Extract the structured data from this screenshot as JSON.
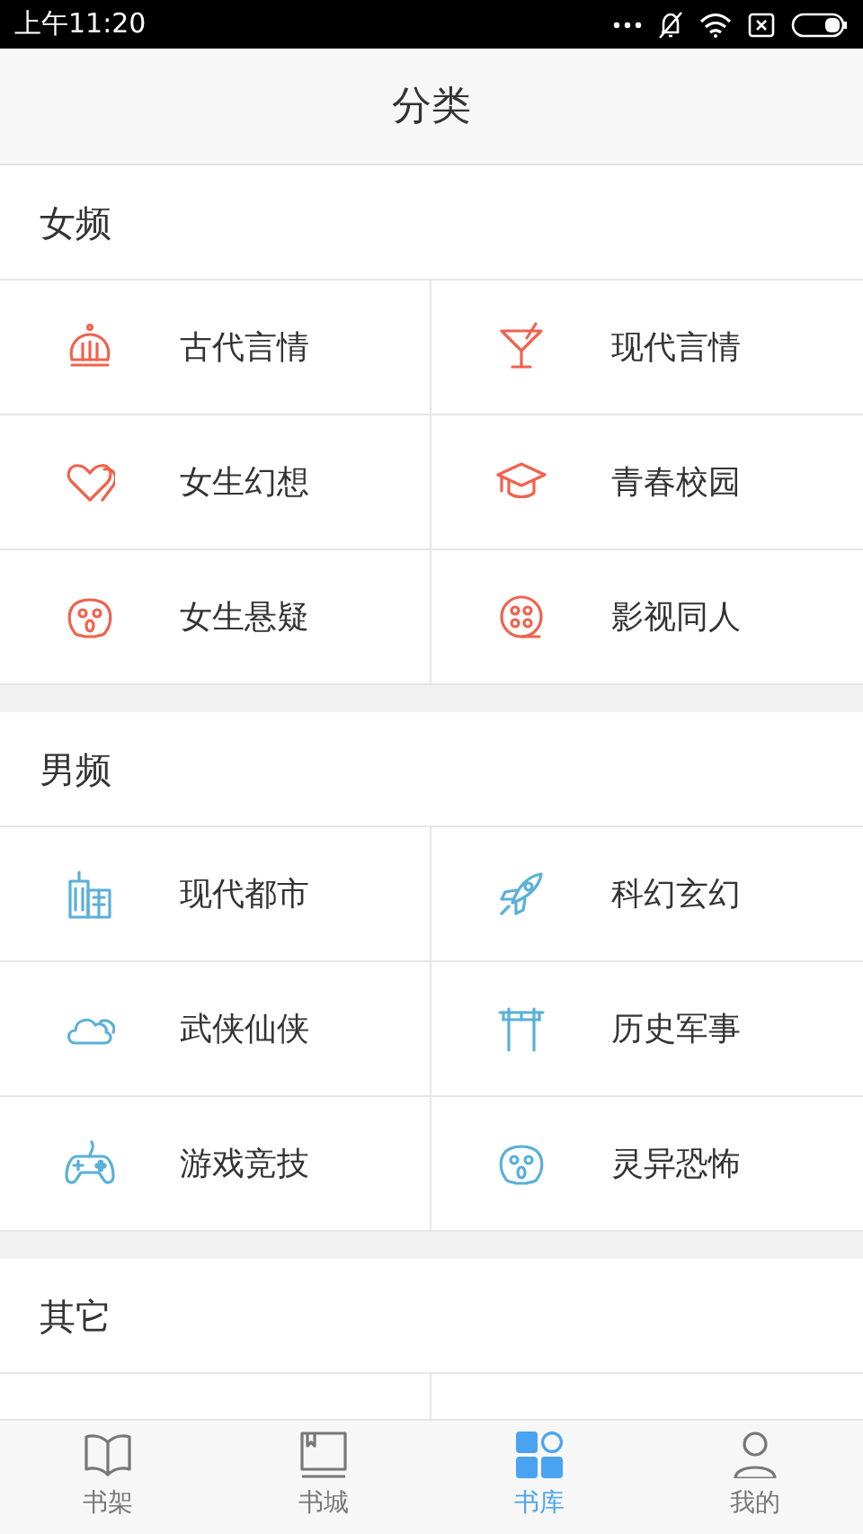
{
  "status_bar": {
    "time": "上午11:20"
  },
  "header": {
    "title": "分类"
  },
  "sections": [
    {
      "title": "女频",
      "items": [
        {
          "label": "古代言情",
          "kind": "crown",
          "color": "#f0624d"
        },
        {
          "label": "现代言情",
          "kind": "cocktail",
          "color": "#f0624d"
        },
        {
          "label": "女生幻想",
          "kind": "hearts",
          "color": "#f0624d"
        },
        {
          "label": "青春校园",
          "kind": "cap",
          "color": "#f0624d"
        },
        {
          "label": "女生悬疑",
          "kind": "skull",
          "color": "#f0624d"
        },
        {
          "label": "影视同人",
          "kind": "film",
          "color": "#f0624d"
        }
      ]
    },
    {
      "title": "男频",
      "items": [
        {
          "label": "现代都市",
          "kind": "city",
          "color": "#5ab0d8"
        },
        {
          "label": "科幻玄幻",
          "kind": "rocket",
          "color": "#5ab0d8"
        },
        {
          "label": "武侠仙侠",
          "kind": "cloud",
          "color": "#5ab0d8"
        },
        {
          "label": "历史军事",
          "kind": "gate",
          "color": "#5ab0d8"
        },
        {
          "label": "游戏竞技",
          "kind": "gamepad",
          "color": "#5ab0d8"
        },
        {
          "label": "灵异恐怖",
          "kind": "skull",
          "color": "#5ab0d8"
        }
      ]
    },
    {
      "title": "其它"
    }
  ],
  "tabs": [
    {
      "label": "书架",
      "kind": "open-book",
      "selected": false
    },
    {
      "label": "书城",
      "kind": "book",
      "selected": false
    },
    {
      "label": "书库",
      "kind": "grid",
      "selected": true
    },
    {
      "label": "我的",
      "kind": "person",
      "selected": false
    }
  ]
}
